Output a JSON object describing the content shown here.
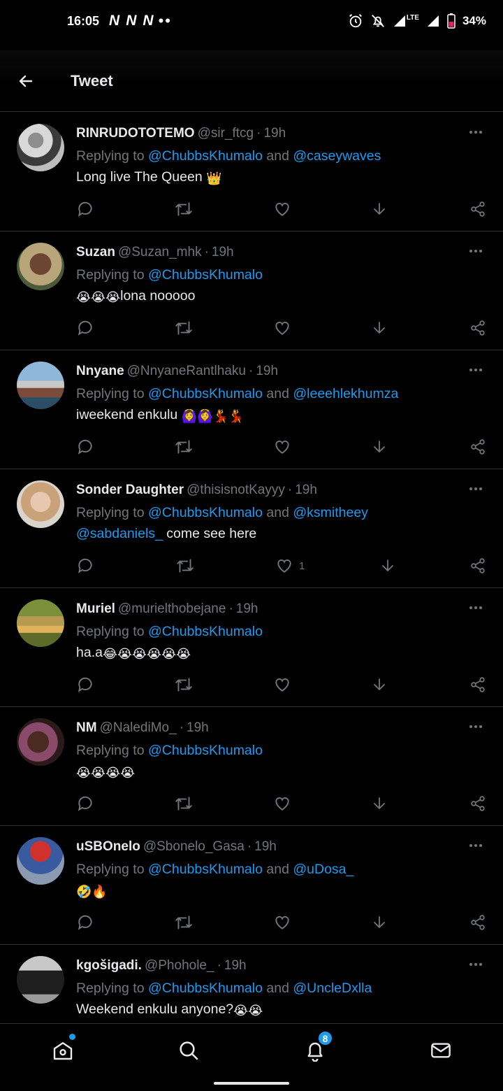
{
  "status_bar": {
    "time": "16:05",
    "app_icons": [
      "N",
      "N",
      "N"
    ],
    "more_dots": "••",
    "network_label": "LTE",
    "battery": "34%"
  },
  "header": {
    "title": "Tweet",
    "back_icon": "arrow-left-icon"
  },
  "colors": {
    "background": "#000000",
    "accent": "#1d9bf0",
    "secondary_text": "#71767b",
    "divider": "#2f3336"
  },
  "tweets": [
    {
      "name": "RINRUDOTOTEMO",
      "handle": "@sir_ftcg",
      "time": "19h",
      "replying_prefix": "Replying to ",
      "mention1": "@ChubbsKhumalo",
      "joiner": " and ",
      "mention2": "@caseywaves",
      "content": "Long live The Queen",
      "emojis": "👑",
      "likes": ""
    },
    {
      "name": "Suzan",
      "handle": "@Suzan_mhk",
      "time": "19h",
      "replying_prefix": "Replying to ",
      "mention1": "@ChubbsKhumalo",
      "lead_emojis": "😭😭😭",
      "content": "lona nooooo",
      "likes": ""
    },
    {
      "name": "Nnyane",
      "handle": "@NnyaneRantlhaku",
      "time": "19h",
      "replying_prefix": "Replying to ",
      "mention1": "@ChubbsKhumalo",
      "joiner": " and ",
      "mention2": "@leeehlekhumza",
      "content": "iweekend enkulu ",
      "emojis": "🙆‍♀️🙆‍♀️💃💃",
      "likes": ""
    },
    {
      "name": "Sonder Daughter",
      "handle": "@thisisnotKayyy",
      "time": "19h",
      "replying_prefix": "Replying to ",
      "mention1": "@ChubbsKhumalo",
      "joiner": " and ",
      "mention2": "@ksmitheey",
      "content_mention": "@sabdaniels_",
      "content": " come see here",
      "likes": "1"
    },
    {
      "name": "Muriel",
      "handle": "@murielthobejane",
      "time": "19h",
      "replying_prefix": "Replying to ",
      "mention1": "@ChubbsKhumalo",
      "content": "ha.a",
      "emojis": "😂😭😭😭😭😭",
      "likes": ""
    },
    {
      "name": "NM",
      "handle": "@NalediMo_",
      "time": "19h",
      "replying_prefix": "Replying to ",
      "mention1": "@ChubbsKhumalo",
      "lead_emojis": "😭😭😭😭",
      "likes": ""
    },
    {
      "name": "uSBOnelo",
      "handle": "@Sbonelo_Gasa",
      "time": "19h",
      "replying_prefix": "Replying to ",
      "mention1": "@ChubbsKhumalo",
      "joiner": " and ",
      "mention2": "@uDosa_",
      "lead_emojis": "🤣🔥",
      "likes": ""
    },
    {
      "name": "kgošigadi.",
      "handle": "@Phohole_",
      "time": "19h",
      "replying_prefix": "Replying to ",
      "mention1": "@ChubbsKhumalo",
      "joiner": " and ",
      "mention2": "@UncleDxlla",
      "content": "Weekend enkulu anyone?",
      "emojis": "😭😭",
      "likes": ""
    }
  ],
  "bottom_nav": {
    "items": [
      "home-icon",
      "search-icon",
      "notifications-icon",
      "messages-icon"
    ],
    "notification_count": "8"
  }
}
